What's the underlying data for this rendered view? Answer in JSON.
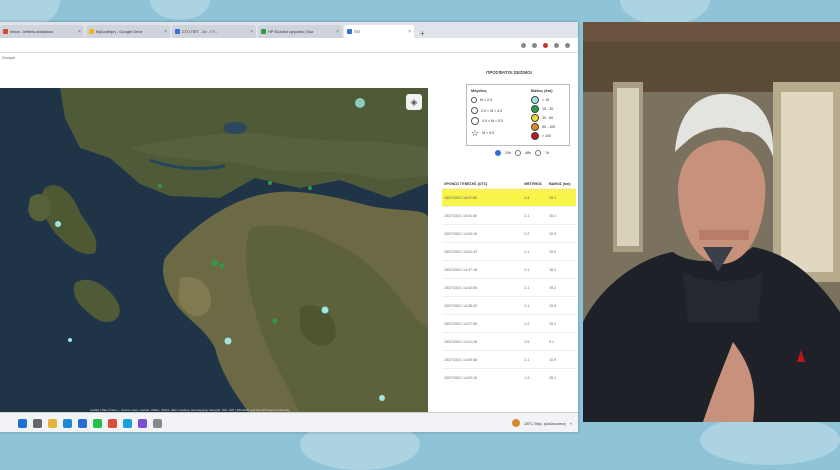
{
  "browser": {
    "tabs": [
      {
        "label": "Inbox - lefteris.sfakianos"
      },
      {
        "label": "Βιβλιοθήκη - Google Drive"
      },
      {
        "label": "ΣΤΟ ΠΕΤ - Dr - ΓΥ..."
      },
      {
        "label": "ΗΡ Ελλάδα εργασίες Όλα"
      }
    ],
    "active_tab": {
      "label": "ΓΕΙ"
    },
    "new_tab_label": "+",
    "url": "",
    "subheader": "Σεισμοί"
  },
  "map": {
    "layers_icon": "layers-icon",
    "attribution": "Leaflet | Tiles © Esri — Source: Esri, i-cubed, USDA, USGS, AEX, GeoEye, Getmapping, Aerogrid, IGN, IGP, UPR-EGP, and the GIS User Community"
  },
  "panel": {
    "title": "ΠΡΟΣΦΑΤΟΙ ΣΕΙΣΜΟΙ",
    "legend": {
      "magnitude_header": "Μέγεθος",
      "depth_header": "Βάθος (km)",
      "magnitude_items": [
        "M < 2.5",
        "2.5 < M < 4.0",
        "4.0 < M < 5.5",
        "M > 5.5"
      ],
      "depth_items": [
        {
          "label": "< 15",
          "color": "#9fe6e0"
        },
        {
          "label": "15 - 30",
          "color": "#2e9b46"
        },
        {
          "label": "30 - 60",
          "color": "#e6e02b"
        },
        {
          "label": "60 - 100",
          "color": "#e08a1e"
        },
        {
          "label": "> 100",
          "color": "#c0141b"
        }
      ]
    },
    "radios": [
      {
        "label": "24h",
        "selected": true
      },
      {
        "label": "48h",
        "selected": false
      },
      {
        "label": "7d",
        "selected": false
      }
    ],
    "table": {
      "headers": [
        "ΧΡΟΝΟΣ ΓΕΝΕΣΗΣ (UTC)",
        "ΜΕΓΕΘΟΣ",
        "ΒΑΘΟΣ (km)"
      ],
      "rows": [
        [
          "15/07/2021 15:07:50",
          "2.4",
          "19.1"
        ],
        [
          "15/07/2021 15:01:40",
          "2.1",
          "15.1"
        ],
        [
          "15/07/2021 14:53:19",
          "2.2",
          "10.9"
        ],
        [
          "15/07/2021 14:51:43",
          "2.1",
          "19.0"
        ],
        [
          "15/07/2021 14:47:18",
          "2.1",
          "18.3"
        ],
        [
          "15/07/2021 14:42:05",
          "2.1",
          "19.2"
        ],
        [
          "15/07/2021 14:38:42",
          "2.1",
          "19.5"
        ],
        [
          "15/07/2021 14:27:55",
          "2.2",
          "19.2"
        ],
        [
          "15/07/2021 14:21:28",
          "2.6",
          "9.1"
        ],
        [
          "15/07/2021 14:09:48",
          "2.1",
          "10.9"
        ],
        [
          "15/07/2021 14:02:15",
          "1.9",
          "15.1"
        ]
      ],
      "highlight_color": "#f8f44a"
    }
  },
  "taskbar": {
    "icons": [
      {
        "name": "windows-start-icon",
        "color": "#1f6fd6"
      },
      {
        "name": "search-icon",
        "color": "#666666"
      },
      {
        "name": "file-explorer-icon",
        "color": "#e8b23a"
      },
      {
        "name": "edge-icon",
        "color": "#1a8ad6"
      },
      {
        "name": "mail-icon",
        "color": "#2a6cd6"
      },
      {
        "name": "whatsapp-icon",
        "color": "#27c04a"
      },
      {
        "name": "chrome-icon",
        "color": "#dd4b39"
      },
      {
        "name": "skype-icon",
        "color": "#1aa0e0"
      },
      {
        "name": "photos-icon",
        "color": "#7a4fd6"
      },
      {
        "name": "app-icon",
        "color": "#888888"
      }
    ],
    "weather": "28°C Μέρ. ηλιόλουστος"
  }
}
